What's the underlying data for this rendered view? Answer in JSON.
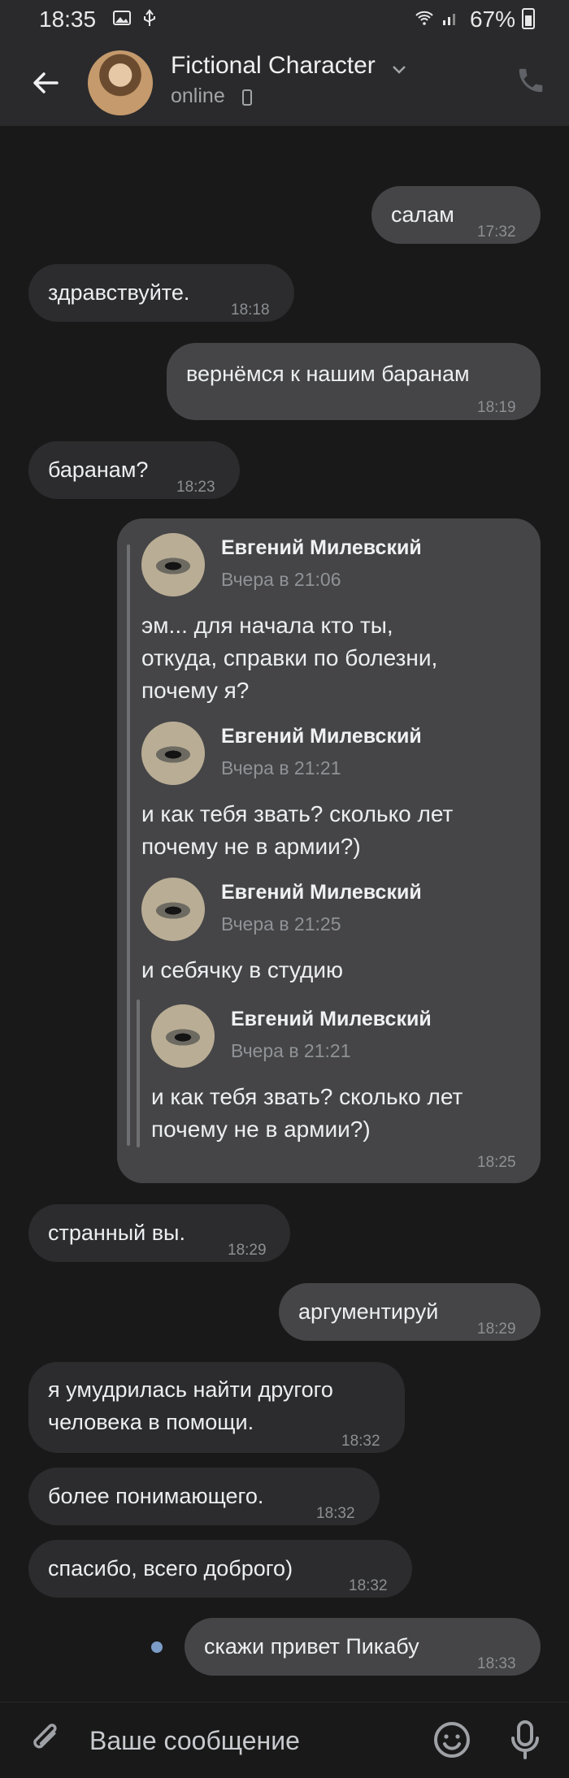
{
  "status_bar": {
    "time": "18:35",
    "battery": "67%"
  },
  "header": {
    "contact_name": "Fictional Character",
    "contact_status": "online"
  },
  "messages": [
    {
      "dir": "out",
      "text": "салам",
      "time": "17:32"
    },
    {
      "dir": "in",
      "text": "здравствуйте.",
      "time": "18:18"
    },
    {
      "dir": "out",
      "text": "вернёмся к нашим баранам",
      "time": "18:19"
    },
    {
      "dir": "in",
      "text": "баранам?",
      "time": "18:23"
    },
    {
      "dir": "in",
      "text": "странный вы.",
      "time": "18:29"
    },
    {
      "dir": "out",
      "text": "аргументируй",
      "time": "18:29"
    },
    {
      "dir": "in",
      "text_lines": [
        "я умудрилась найти другого",
        "человека в помощи."
      ],
      "time": "18:32"
    },
    {
      "dir": "in",
      "text": "более понимающего.",
      "time": "18:32"
    },
    {
      "dir": "in",
      "text": "спасибо, всего доброго)",
      "time": "18:32"
    },
    {
      "dir": "out",
      "text": "скажи привет Пикабу",
      "time": "18:33"
    }
  ],
  "forwarded": {
    "time": "18:25",
    "items": [
      {
        "author": "Евгений Милевский",
        "date": "Вчера в 21:06",
        "lines": [
          "эм... для начала кто ты,",
          "откуда, справки по болезни,",
          "почему я?"
        ]
      },
      {
        "author": "Евгений Милевский",
        "date": "Вчера в 21:21",
        "lines": [
          "и как тебя звать? сколько лет",
          "почему не в армии?)"
        ]
      },
      {
        "author": "Евгений Милевский",
        "date": "Вчера в 21:25",
        "lines": [
          "и себячку в студию"
        ]
      }
    ],
    "nested": {
      "author": "Евгений Милевский",
      "date": "Вчера в 21:21",
      "lines": [
        "и как тебя звать? сколько лет",
        "почему не в армии?)"
      ]
    }
  },
  "composer": {
    "placeholder": "Ваше сообщение"
  },
  "icons": [
    "back-arrow-icon",
    "chevron-down-icon",
    "call-icon",
    "attach-icon",
    "emoji-icon",
    "microphone-icon",
    "gallery-icon",
    "usb-icon",
    "wifi-icon",
    "signal-icon",
    "battery-icon"
  ]
}
